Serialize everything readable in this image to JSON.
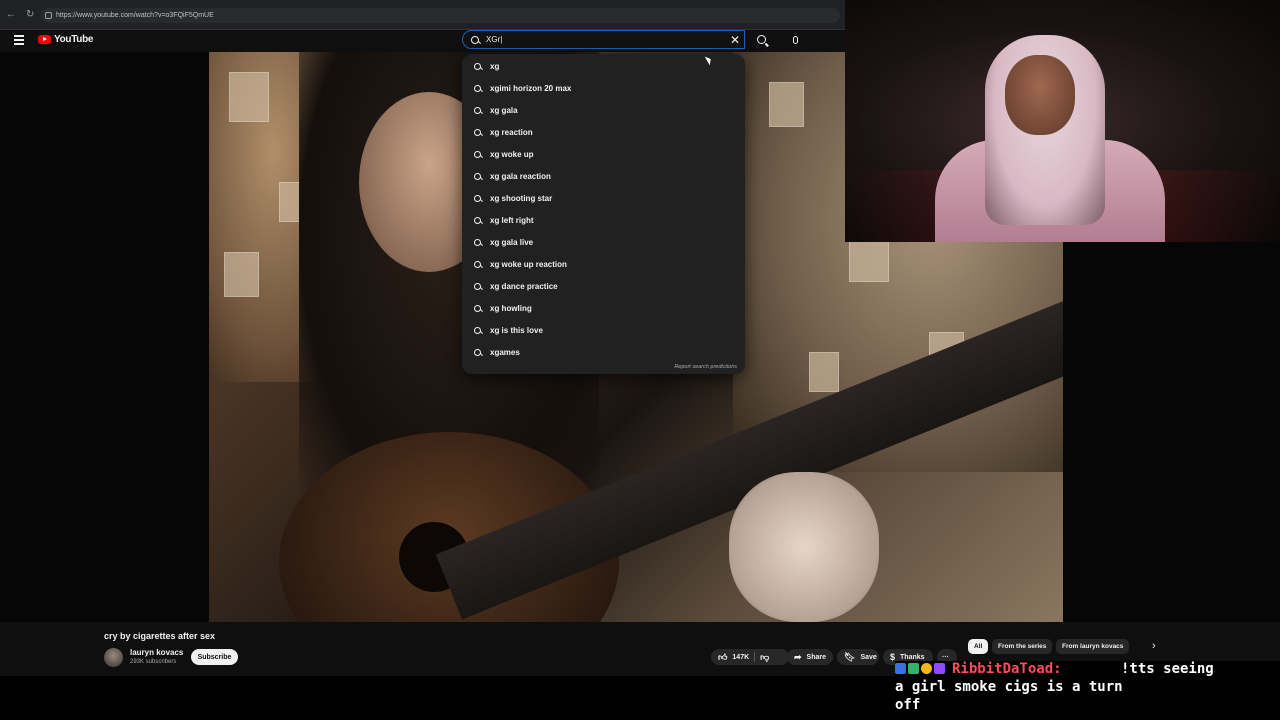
{
  "browser": {
    "url": "https://www.youtube.com/watch?v=o3FQiF5QmUE"
  },
  "header": {
    "logo_text": "YouTube",
    "search_value": "XGr|",
    "icons": [
      "menu-icon",
      "youtube-logo",
      "search-icon",
      "clear-icon",
      "mic-icon"
    ]
  },
  "suggestions": {
    "items": [
      "xg",
      "xgimi horizon 20 max",
      "xg gala",
      "xg reaction",
      "xg woke up",
      "xg gala reaction",
      "xg shooting star",
      "xg left right",
      "xg gala live",
      "xg woke up reaction",
      "xg dance practice",
      "xg howling",
      "xg is this love",
      "xgames"
    ],
    "report_label": "Report search predictions"
  },
  "video": {
    "title": "cry by cigarettes after sex",
    "channel": "lauryn kovacs",
    "subscribers": "293K subscribers",
    "subscribe_label": "Subscribe",
    "likes": "147K",
    "share_label": "Share",
    "save_label": "Save",
    "thanks_label": "Thanks",
    "more_label": "···"
  },
  "chips": {
    "items": [
      "All",
      "From the series",
      "From lauryn kovacs"
    ],
    "active": "All",
    "next_label": "›"
  },
  "chat": {
    "username": "RibbitDaToad:",
    "message_part1": "!tts seeing",
    "message_part2": "a girl smoke cigs is a turn",
    "message_part3": "off",
    "colors": {
      "username": "#ff4b5c",
      "text": "#ffffff"
    }
  },
  "colors": {
    "background": "#0f0f0f",
    "accent_red": "#ff0000",
    "search_border": "#1c62b9",
    "dropdown_bg": "#212121"
  }
}
